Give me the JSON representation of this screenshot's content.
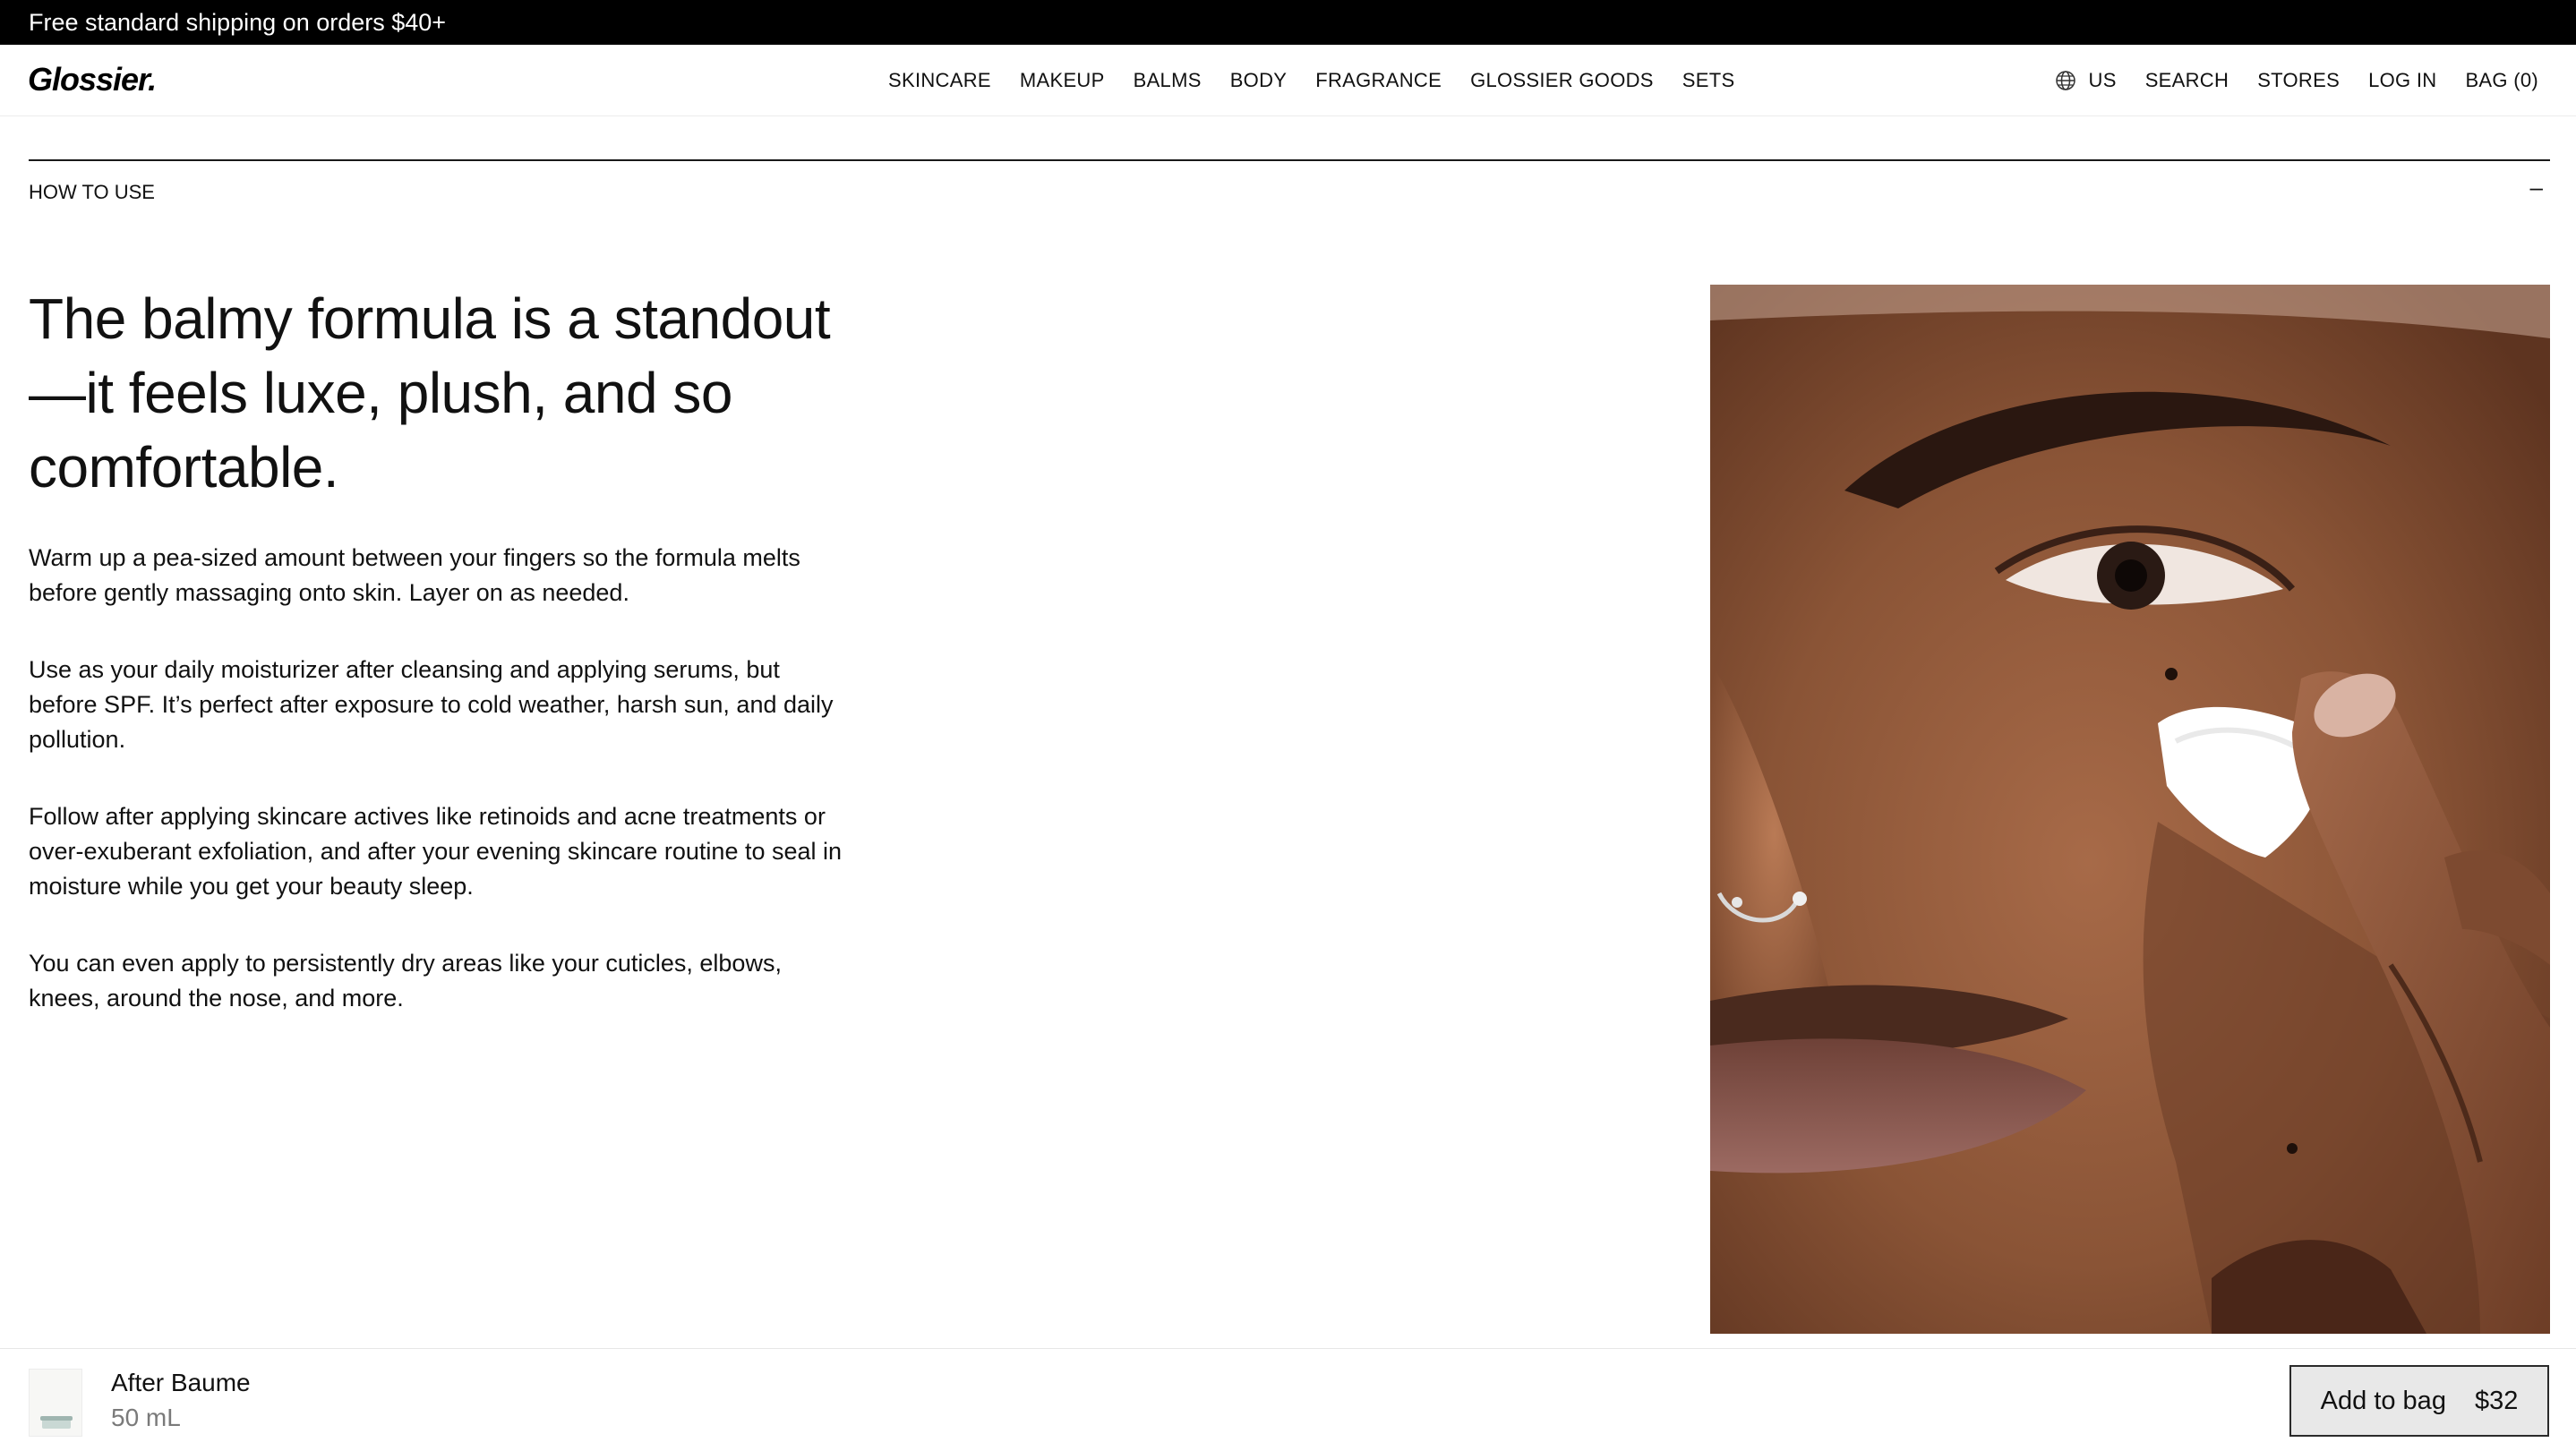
{
  "promo": {
    "text": "Free standard shipping on orders $40+"
  },
  "header": {
    "logo": "Glossier.",
    "nav": [
      "SKINCARE",
      "MAKEUP",
      "BALMS",
      "BODY",
      "FRAGRANCE",
      "GLOSSIER GOODS",
      "SETS"
    ],
    "utility": {
      "region_icon": "globe-icon",
      "region": "US",
      "search": "SEARCH",
      "stores": "STORES",
      "login": "LOG IN",
      "bag": "BAG (0)"
    }
  },
  "accordion": {
    "title": "HOW TO USE",
    "toggle": "–",
    "expanded": true
  },
  "content": {
    "headline": "The balmy formula is a standout—it feels luxe, plush, and so comfortable.",
    "paragraphs": [
      "Warm up a pea-sized amount between your fingers so the formula melts before gently massaging onto skin. Layer on as needed.",
      "Use as your daily moisturizer after cleansing and applying serums, but before SPF. It’s perfect after exposure to cold weather, harsh sun, and daily pollution.",
      "Follow after applying skincare actives like retinoids and acne treatments or over-exuberant exfoliation, and after your evening skincare routine to seal in moisture while you get your beauty sleep.",
      "You can even apply to persistently dry areas like your cuticles, elbows, knees, around the nose, and more."
    ]
  },
  "sticky": {
    "product_name": "After Baume",
    "size": "50 mL",
    "button_label": "Add to bag",
    "price": "$32"
  },
  "colors": {
    "promo_bg": "#000000",
    "text": "#111111",
    "muted": "#7a7a7a",
    "button_bg": "#e8e8e8"
  }
}
